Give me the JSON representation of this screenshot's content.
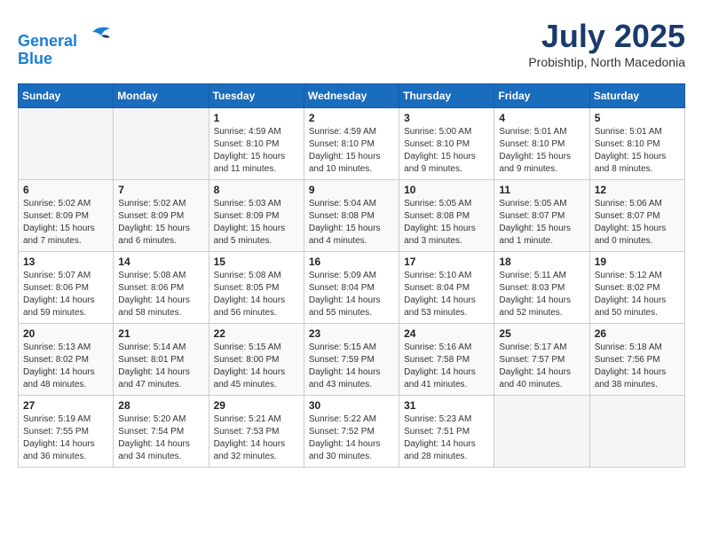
{
  "header": {
    "logo_line1": "General",
    "logo_line2": "Blue",
    "month": "July 2025",
    "location": "Probishtip, North Macedonia"
  },
  "days_of_week": [
    "Sunday",
    "Monday",
    "Tuesday",
    "Wednesday",
    "Thursday",
    "Friday",
    "Saturday"
  ],
  "weeks": [
    [
      {
        "day": "",
        "content": ""
      },
      {
        "day": "",
        "content": ""
      },
      {
        "day": "1",
        "content": "Sunrise: 4:59 AM\nSunset: 8:10 PM\nDaylight: 15 hours and 11 minutes."
      },
      {
        "day": "2",
        "content": "Sunrise: 4:59 AM\nSunset: 8:10 PM\nDaylight: 15 hours and 10 minutes."
      },
      {
        "day": "3",
        "content": "Sunrise: 5:00 AM\nSunset: 8:10 PM\nDaylight: 15 hours and 9 minutes."
      },
      {
        "day": "4",
        "content": "Sunrise: 5:01 AM\nSunset: 8:10 PM\nDaylight: 15 hours and 9 minutes."
      },
      {
        "day": "5",
        "content": "Sunrise: 5:01 AM\nSunset: 8:10 PM\nDaylight: 15 hours and 8 minutes."
      }
    ],
    [
      {
        "day": "6",
        "content": "Sunrise: 5:02 AM\nSunset: 8:09 PM\nDaylight: 15 hours and 7 minutes."
      },
      {
        "day": "7",
        "content": "Sunrise: 5:02 AM\nSunset: 8:09 PM\nDaylight: 15 hours and 6 minutes."
      },
      {
        "day": "8",
        "content": "Sunrise: 5:03 AM\nSunset: 8:09 PM\nDaylight: 15 hours and 5 minutes."
      },
      {
        "day": "9",
        "content": "Sunrise: 5:04 AM\nSunset: 8:08 PM\nDaylight: 15 hours and 4 minutes."
      },
      {
        "day": "10",
        "content": "Sunrise: 5:05 AM\nSunset: 8:08 PM\nDaylight: 15 hours and 3 minutes."
      },
      {
        "day": "11",
        "content": "Sunrise: 5:05 AM\nSunset: 8:07 PM\nDaylight: 15 hours and 1 minute."
      },
      {
        "day": "12",
        "content": "Sunrise: 5:06 AM\nSunset: 8:07 PM\nDaylight: 15 hours and 0 minutes."
      }
    ],
    [
      {
        "day": "13",
        "content": "Sunrise: 5:07 AM\nSunset: 8:06 PM\nDaylight: 14 hours and 59 minutes."
      },
      {
        "day": "14",
        "content": "Sunrise: 5:08 AM\nSunset: 8:06 PM\nDaylight: 14 hours and 58 minutes."
      },
      {
        "day": "15",
        "content": "Sunrise: 5:08 AM\nSunset: 8:05 PM\nDaylight: 14 hours and 56 minutes."
      },
      {
        "day": "16",
        "content": "Sunrise: 5:09 AM\nSunset: 8:04 PM\nDaylight: 14 hours and 55 minutes."
      },
      {
        "day": "17",
        "content": "Sunrise: 5:10 AM\nSunset: 8:04 PM\nDaylight: 14 hours and 53 minutes."
      },
      {
        "day": "18",
        "content": "Sunrise: 5:11 AM\nSunset: 8:03 PM\nDaylight: 14 hours and 52 minutes."
      },
      {
        "day": "19",
        "content": "Sunrise: 5:12 AM\nSunset: 8:02 PM\nDaylight: 14 hours and 50 minutes."
      }
    ],
    [
      {
        "day": "20",
        "content": "Sunrise: 5:13 AM\nSunset: 8:02 PM\nDaylight: 14 hours and 48 minutes."
      },
      {
        "day": "21",
        "content": "Sunrise: 5:14 AM\nSunset: 8:01 PM\nDaylight: 14 hours and 47 minutes."
      },
      {
        "day": "22",
        "content": "Sunrise: 5:15 AM\nSunset: 8:00 PM\nDaylight: 14 hours and 45 minutes."
      },
      {
        "day": "23",
        "content": "Sunrise: 5:15 AM\nSunset: 7:59 PM\nDaylight: 14 hours and 43 minutes."
      },
      {
        "day": "24",
        "content": "Sunrise: 5:16 AM\nSunset: 7:58 PM\nDaylight: 14 hours and 41 minutes."
      },
      {
        "day": "25",
        "content": "Sunrise: 5:17 AM\nSunset: 7:57 PM\nDaylight: 14 hours and 40 minutes."
      },
      {
        "day": "26",
        "content": "Sunrise: 5:18 AM\nSunset: 7:56 PM\nDaylight: 14 hours and 38 minutes."
      }
    ],
    [
      {
        "day": "27",
        "content": "Sunrise: 5:19 AM\nSunset: 7:55 PM\nDaylight: 14 hours and 36 minutes."
      },
      {
        "day": "28",
        "content": "Sunrise: 5:20 AM\nSunset: 7:54 PM\nDaylight: 14 hours and 34 minutes."
      },
      {
        "day": "29",
        "content": "Sunrise: 5:21 AM\nSunset: 7:53 PM\nDaylight: 14 hours and 32 minutes."
      },
      {
        "day": "30",
        "content": "Sunrise: 5:22 AM\nSunset: 7:52 PM\nDaylight: 14 hours and 30 minutes."
      },
      {
        "day": "31",
        "content": "Sunrise: 5:23 AM\nSunset: 7:51 PM\nDaylight: 14 hours and 28 minutes."
      },
      {
        "day": "",
        "content": ""
      },
      {
        "day": "",
        "content": ""
      }
    ]
  ]
}
